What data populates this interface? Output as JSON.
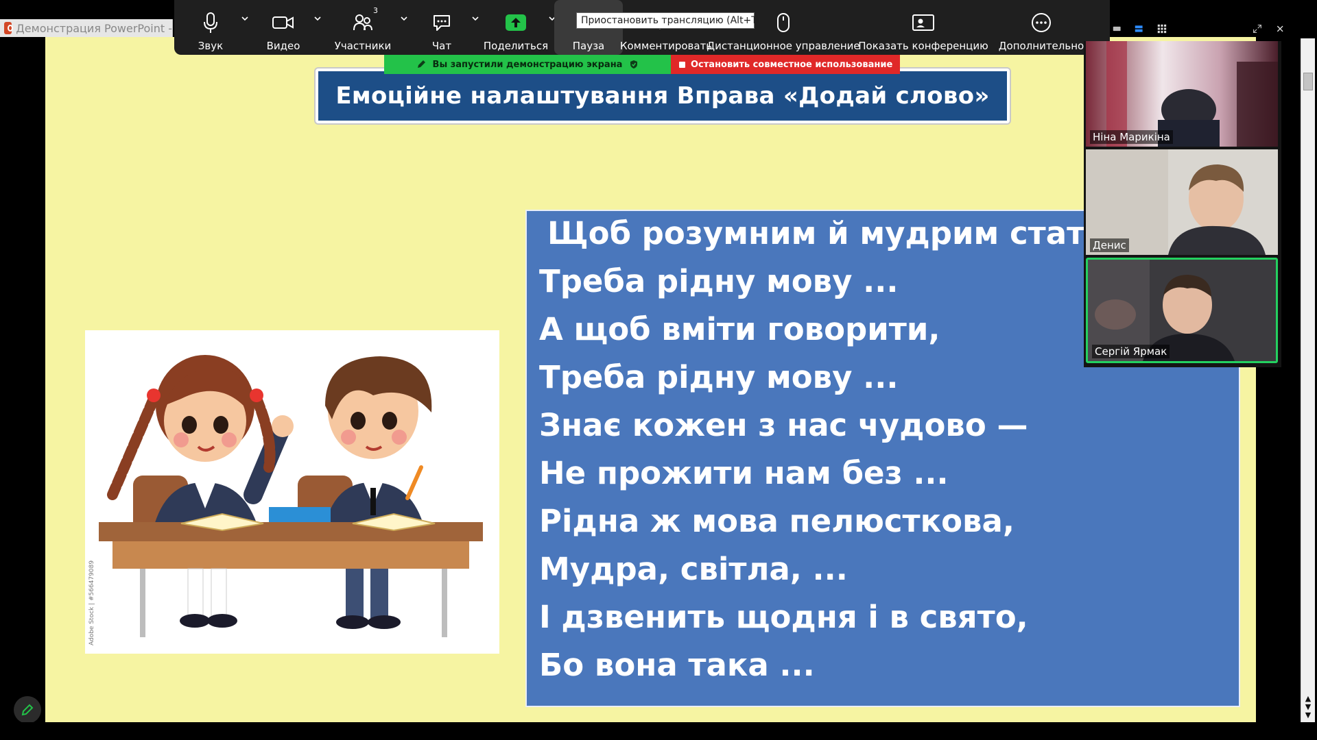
{
  "window": {
    "tab_label": "Демонстрация PowerPoint -"
  },
  "toolbar": {
    "items": [
      {
        "name": "audio",
        "label": "Звук",
        "icon": "microphone-icon"
      },
      {
        "name": "video",
        "label": "Видео",
        "icon": "camera-icon"
      },
      {
        "name": "participants",
        "label": "Участники",
        "icon": "people-icon",
        "count": "3"
      },
      {
        "name": "chat",
        "label": "Чат",
        "icon": "chat-icon"
      },
      {
        "name": "share",
        "label": "Поделиться",
        "icon": "share-up-icon"
      },
      {
        "name": "pause",
        "label": "Пауза",
        "icon": "pause-icon"
      },
      {
        "name": "annotate",
        "label": "Комментировать",
        "icon": "pen-icon"
      },
      {
        "name": "remote-control",
        "label": "Дистанционное управление",
        "icon": "mouse-icon"
      },
      {
        "name": "show-meeting",
        "label": "Показать конференцию",
        "icon": "meeting-window-icon"
      },
      {
        "name": "more",
        "label": "Дополнительно",
        "icon": "more-dots-icon"
      }
    ],
    "pause_tooltip": "Приостановить трансляцию (Alt+T)"
  },
  "status": {
    "sharing_text": "Вы запустили демонстрацию экрана",
    "stop_text": "Остановить совместное использование",
    "sharing_color": "#23c249",
    "stop_color": "#e02828"
  },
  "slide": {
    "title": "Емоційне налаштування  Вправа «Додай слово»",
    "poem_lines": [
      "Щоб розумним й мудрим стати,",
      "Треба рідну мову ...",
      "А щоб вміти говорити,",
      "Треба рідну мову ...",
      "Знає кожен з нас чудово —",
      "Не прожити нам без ...",
      "Рідна ж мова пелюсткова,",
      "Мудра, світла, ...",
      "І дзвенить щодня і в свято,",
      "Бо вона така ..."
    ],
    "image_watermark": "Adobe Stock | #566479089",
    "background_color": "#f6f4a2",
    "title_color": "#1d4e87",
    "poem_box_color": "#4a77bc"
  },
  "participants": [
    {
      "name": "Ніна Марикіна",
      "active": false
    },
    {
      "name": "Денис",
      "active": false
    },
    {
      "name": "Сергій Ярмак",
      "active": true
    }
  ]
}
